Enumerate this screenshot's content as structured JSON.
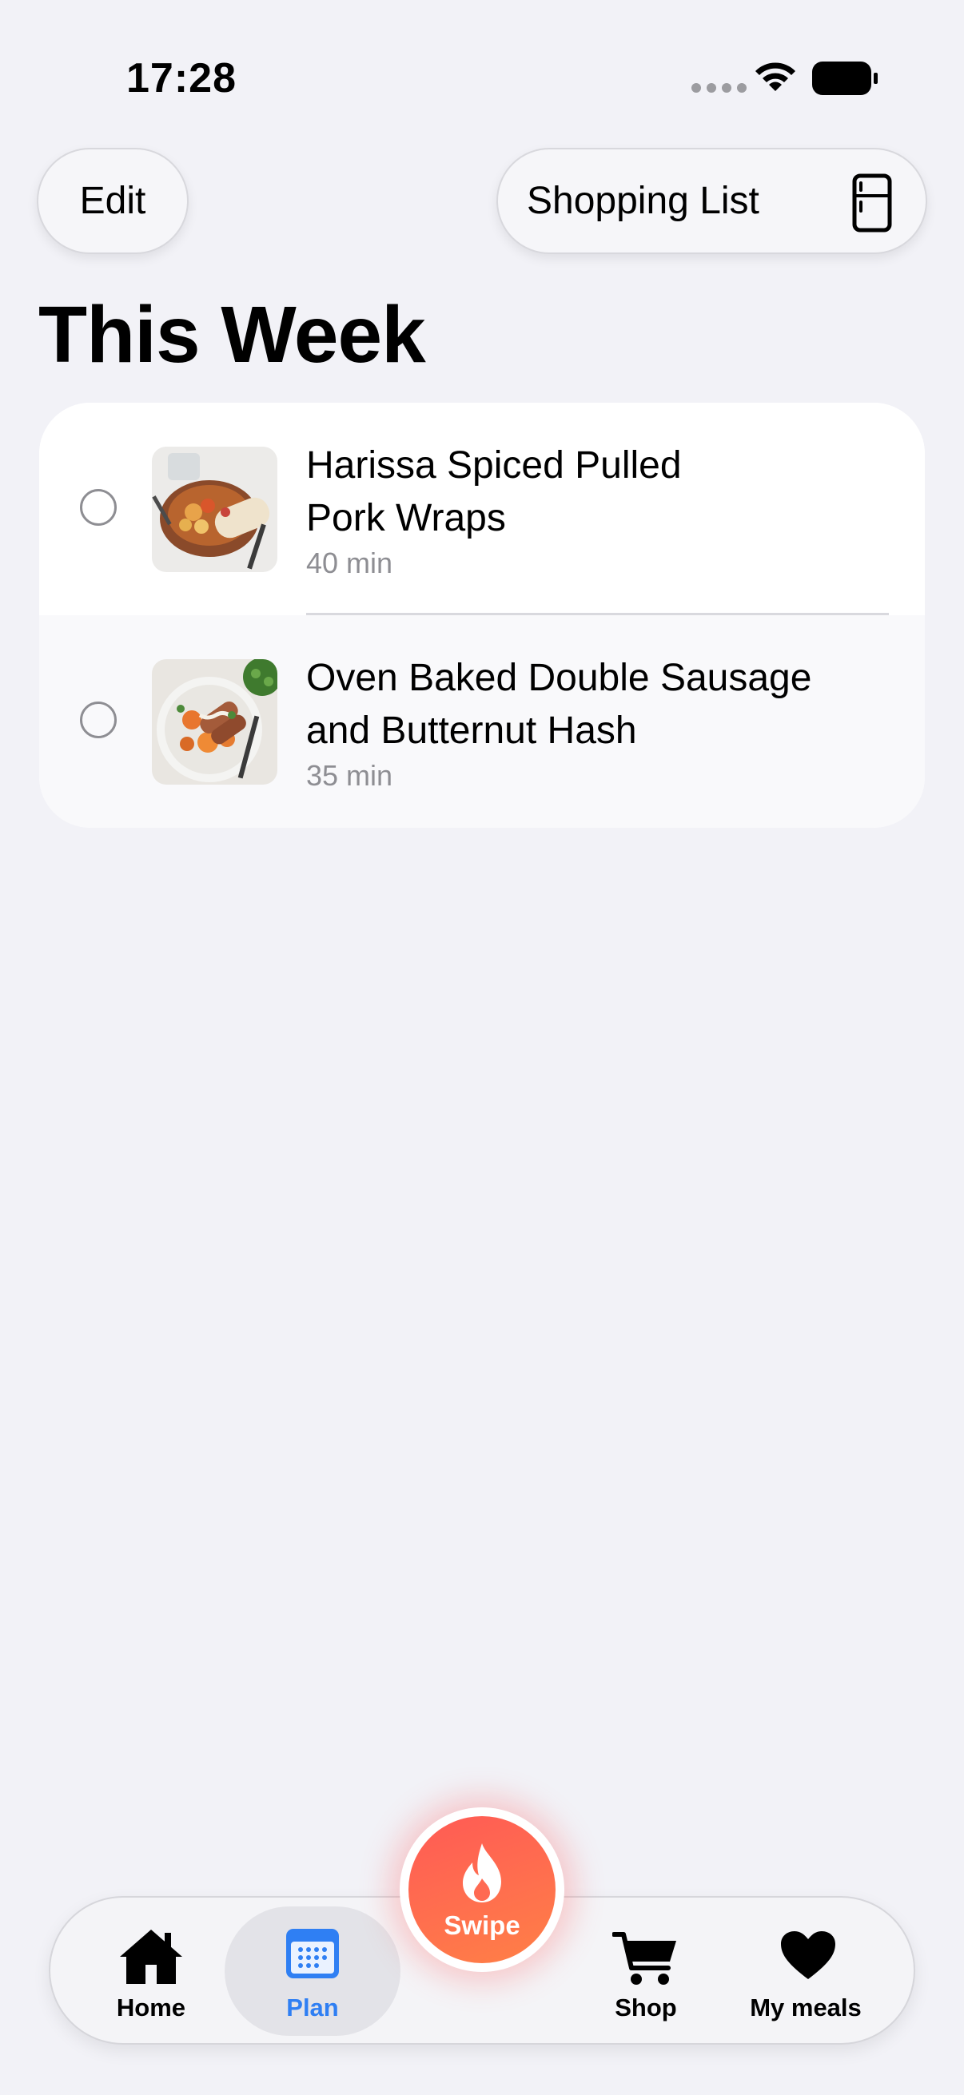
{
  "status_bar": {
    "time": "17:28"
  },
  "header": {
    "edit_label": "Edit",
    "shopping_list_label": "Shopping List",
    "title": "This Week"
  },
  "meals": [
    {
      "name_line1": "Harissa Spiced Pulled",
      "name_line2": "Pork Wraps",
      "time": "40 min",
      "completed": false
    },
    {
      "name_line1": "Oven Baked Double Sausage",
      "name_line2": "and Butternut Hash",
      "time": "35 min",
      "completed": false
    }
  ],
  "tab_bar": {
    "home_label": "Home",
    "plan_label": "Plan",
    "swipe_label": "Swipe",
    "shop_label": "Shop",
    "my_meals_label": "My meals",
    "selected": "Plan"
  },
  "colors": {
    "accent_blue": "#2f7ff3",
    "swipe_gradient_start": "#ff5a55",
    "swipe_gradient_end": "#ff8046",
    "background": "#f2f2f7"
  }
}
